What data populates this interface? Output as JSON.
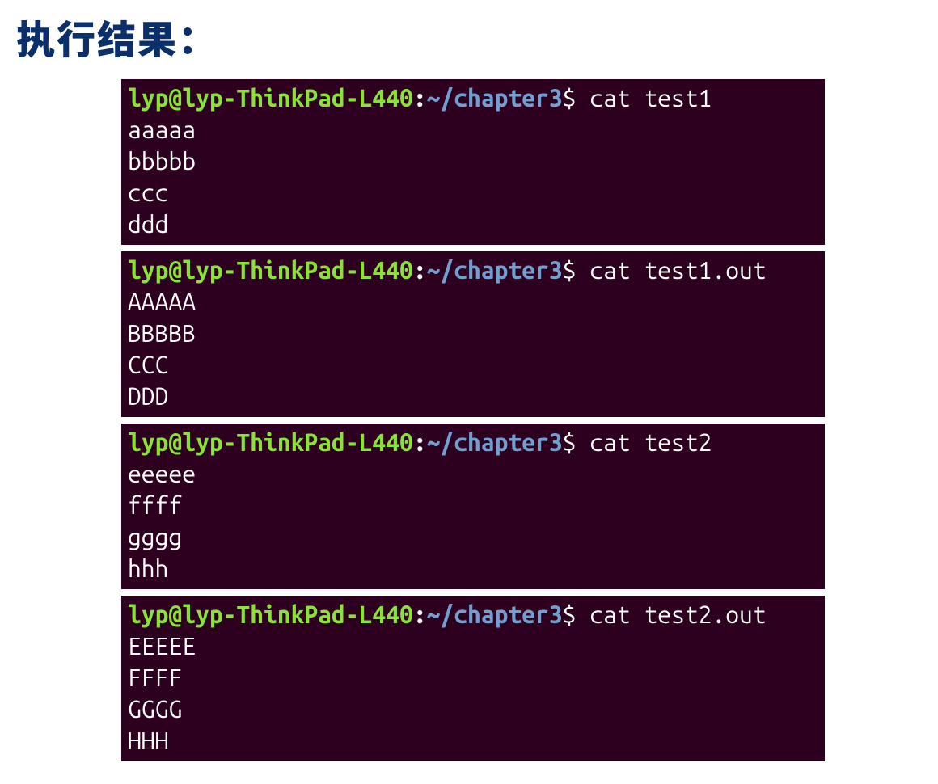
{
  "heading": "执行结果：",
  "prompt": {
    "user": "lyp",
    "at": "@",
    "host": "lyp-ThinkPad-L440",
    "colon": ":",
    "path": "~/chapter3",
    "dollar": "$ "
  },
  "blocks": [
    {
      "command": "cat test1",
      "output": [
        "aaaaa",
        "bbbbb",
        "ccc",
        "ddd"
      ]
    },
    {
      "command": "cat test1.out",
      "output": [
        "AAAAA",
        "BBBBB",
        "CCC",
        "DDD"
      ]
    },
    {
      "command": "cat test2",
      "output": [
        "eeeee",
        "ffff",
        "gggg",
        "hhh"
      ]
    },
    {
      "command": "cat test2.out",
      "output": [
        "EEEEE",
        "FFFF",
        "GGGG",
        "HHH"
      ]
    }
  ]
}
